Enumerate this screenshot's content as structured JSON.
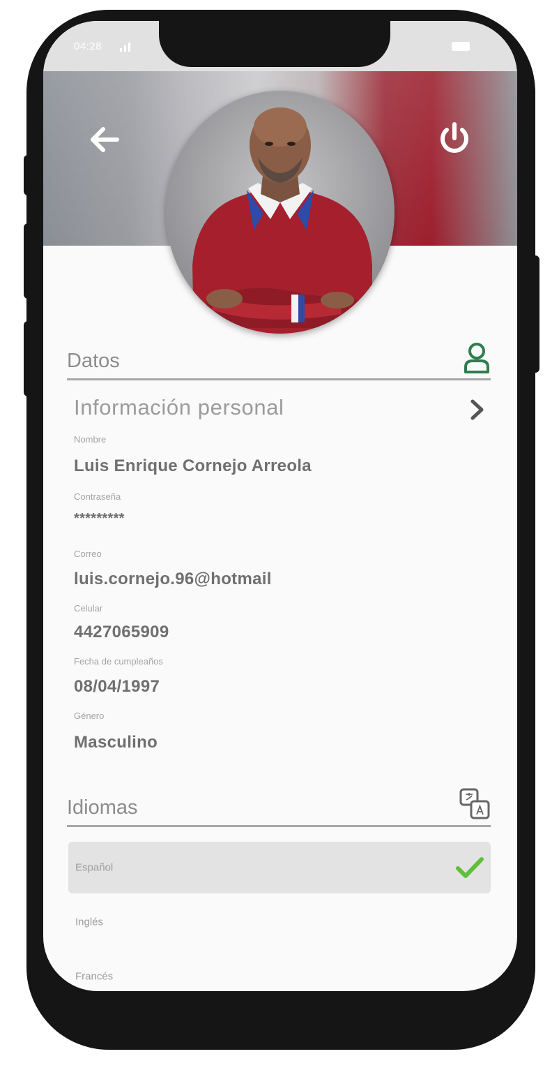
{
  "status_bar": {
    "time": "04:28"
  },
  "profile": {
    "section_title": "Datos",
    "info_title": "Información personal",
    "fields": [
      {
        "label": "Nombre",
        "value": "Luis Enrique Cornejo Arreola"
      },
      {
        "label": "Contraseña",
        "value": "*********"
      },
      {
        "label": "Correo",
        "value": "luis.cornejo.96@hotmail"
      },
      {
        "label": "Celular",
        "value": "4427065909"
      },
      {
        "label": "Fecha de cumpleaños",
        "value": "08/04/1997"
      },
      {
        "label": "Género",
        "value": "Masculino"
      }
    ]
  },
  "languages": {
    "section_title": "Idiomas",
    "items": [
      {
        "label": "Español",
        "selected": true
      },
      {
        "label": "Inglés",
        "selected": false
      },
      {
        "label": "Francés",
        "selected": false
      }
    ]
  },
  "icons": {
    "back": "arrow-left-icon",
    "power": "power-icon",
    "person": "person-icon",
    "language": "language-icon",
    "chevron": "chevron-right-icon",
    "check": "check-icon"
  },
  "colors": {
    "accent_green": "#2e7d4f",
    "check_green": "#5fbf3a",
    "shirt_red": "#a5202c"
  }
}
